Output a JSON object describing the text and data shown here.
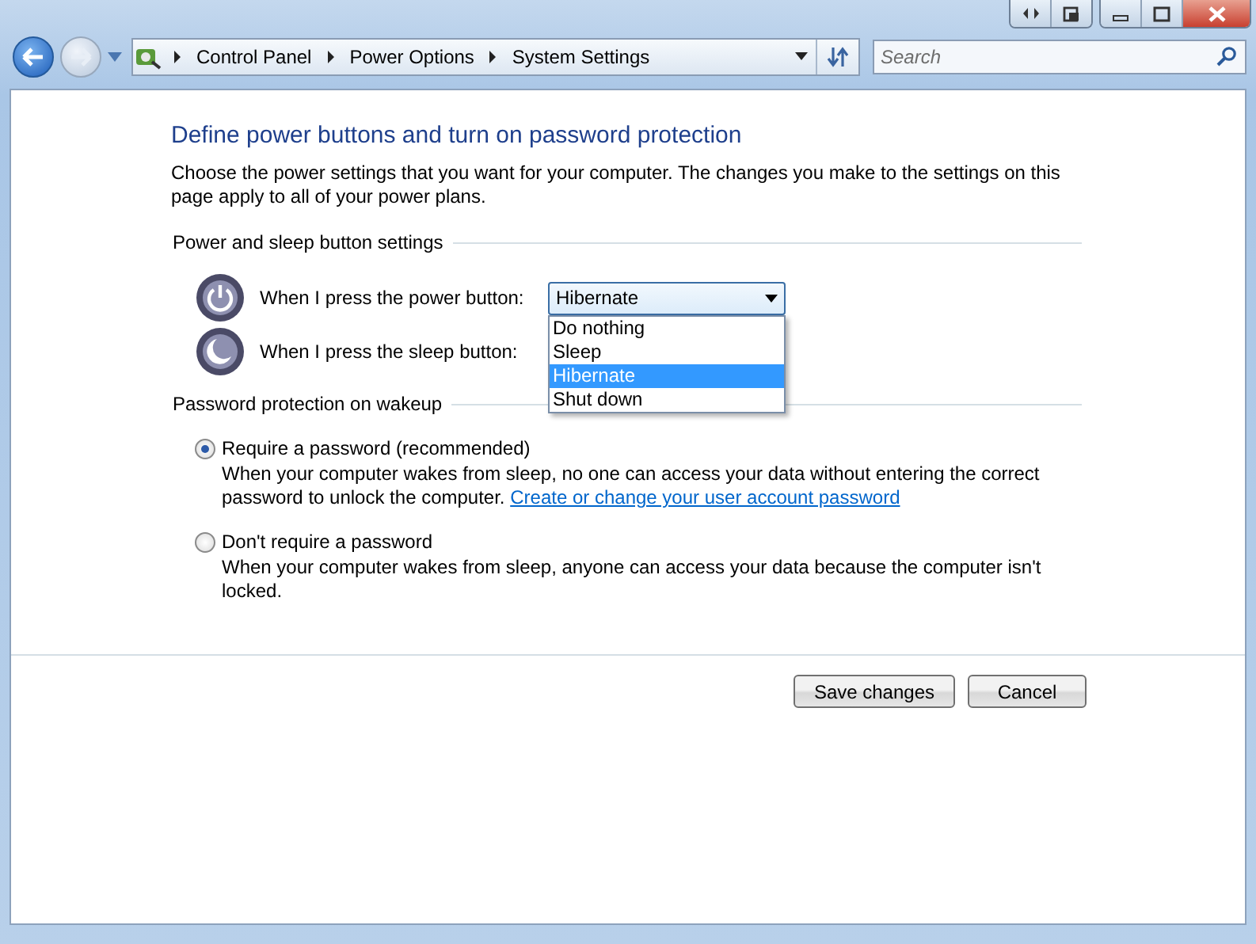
{
  "breadcrumb": [
    "Control Panel",
    "Power Options",
    "System Settings"
  ],
  "search": {
    "placeholder": "Search"
  },
  "heading": "Define power buttons and turn on password protection",
  "intro": "Choose the power settings that you want for your computer. The changes you make to the settings on this page apply to all of your power plans.",
  "button_section": {
    "title": "Power and sleep button settings",
    "rows": [
      {
        "kind": "power",
        "label": "When I press the power button:",
        "dropdown": {
          "value": "Hibernate",
          "expanded": true,
          "options": [
            {
              "label": "Do nothing",
              "selected": false
            },
            {
              "label": "Sleep",
              "selected": false
            },
            {
              "label": "Hibernate",
              "selected": true
            },
            {
              "label": "Shut down",
              "selected": false
            }
          ]
        }
      },
      {
        "kind": "sleep",
        "label": "When I press the sleep button:"
      }
    ]
  },
  "password_section": {
    "title": "Password protection on wakeup",
    "choices": [
      {
        "label": "Require a password (recommended)",
        "selected": true,
        "description": "When your computer wakes from sleep, no one can access your data without entering the correct password to unlock the computer.",
        "link": "Create or change your user account password"
      },
      {
        "label": "Don't require a password",
        "selected": false,
        "description": "When your computer wakes from sleep, anyone can access your data because the computer isn't locked."
      }
    ]
  },
  "buttons": [
    "Save changes",
    "Cancel"
  ]
}
